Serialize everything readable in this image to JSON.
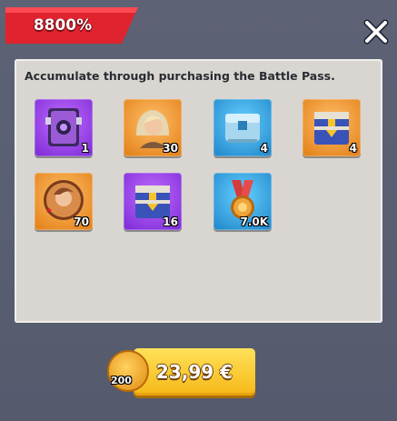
{
  "header": {
    "badge_label": "8800%",
    "close_icon": "close-icon"
  },
  "panel": {
    "description": "Accumulate through purchasing the Battle Pass."
  },
  "rewards": [
    {
      "icon": "purple-crate-icon",
      "quantity": "1"
    },
    {
      "icon": "hero-portrait-icon",
      "quantity": "30"
    },
    {
      "icon": "blue-chest-icon",
      "quantity": "4"
    },
    {
      "icon": "blue-gold-chest-icon",
      "quantity": "4"
    },
    {
      "icon": "hero-token-icon",
      "quantity": "70"
    },
    {
      "icon": "purple-gold-chest-icon",
      "quantity": "16"
    },
    {
      "icon": "medal-icon",
      "quantity": "7.0K"
    }
  ],
  "purchase": {
    "price_label": "23,99 €",
    "bonus_icon": "coin-icon",
    "bonus_quantity": "200"
  },
  "colors": {
    "badge_red": "#e0242f",
    "price_yellow": "#f6c21f",
    "panel_bg": "#d9d6d1"
  }
}
